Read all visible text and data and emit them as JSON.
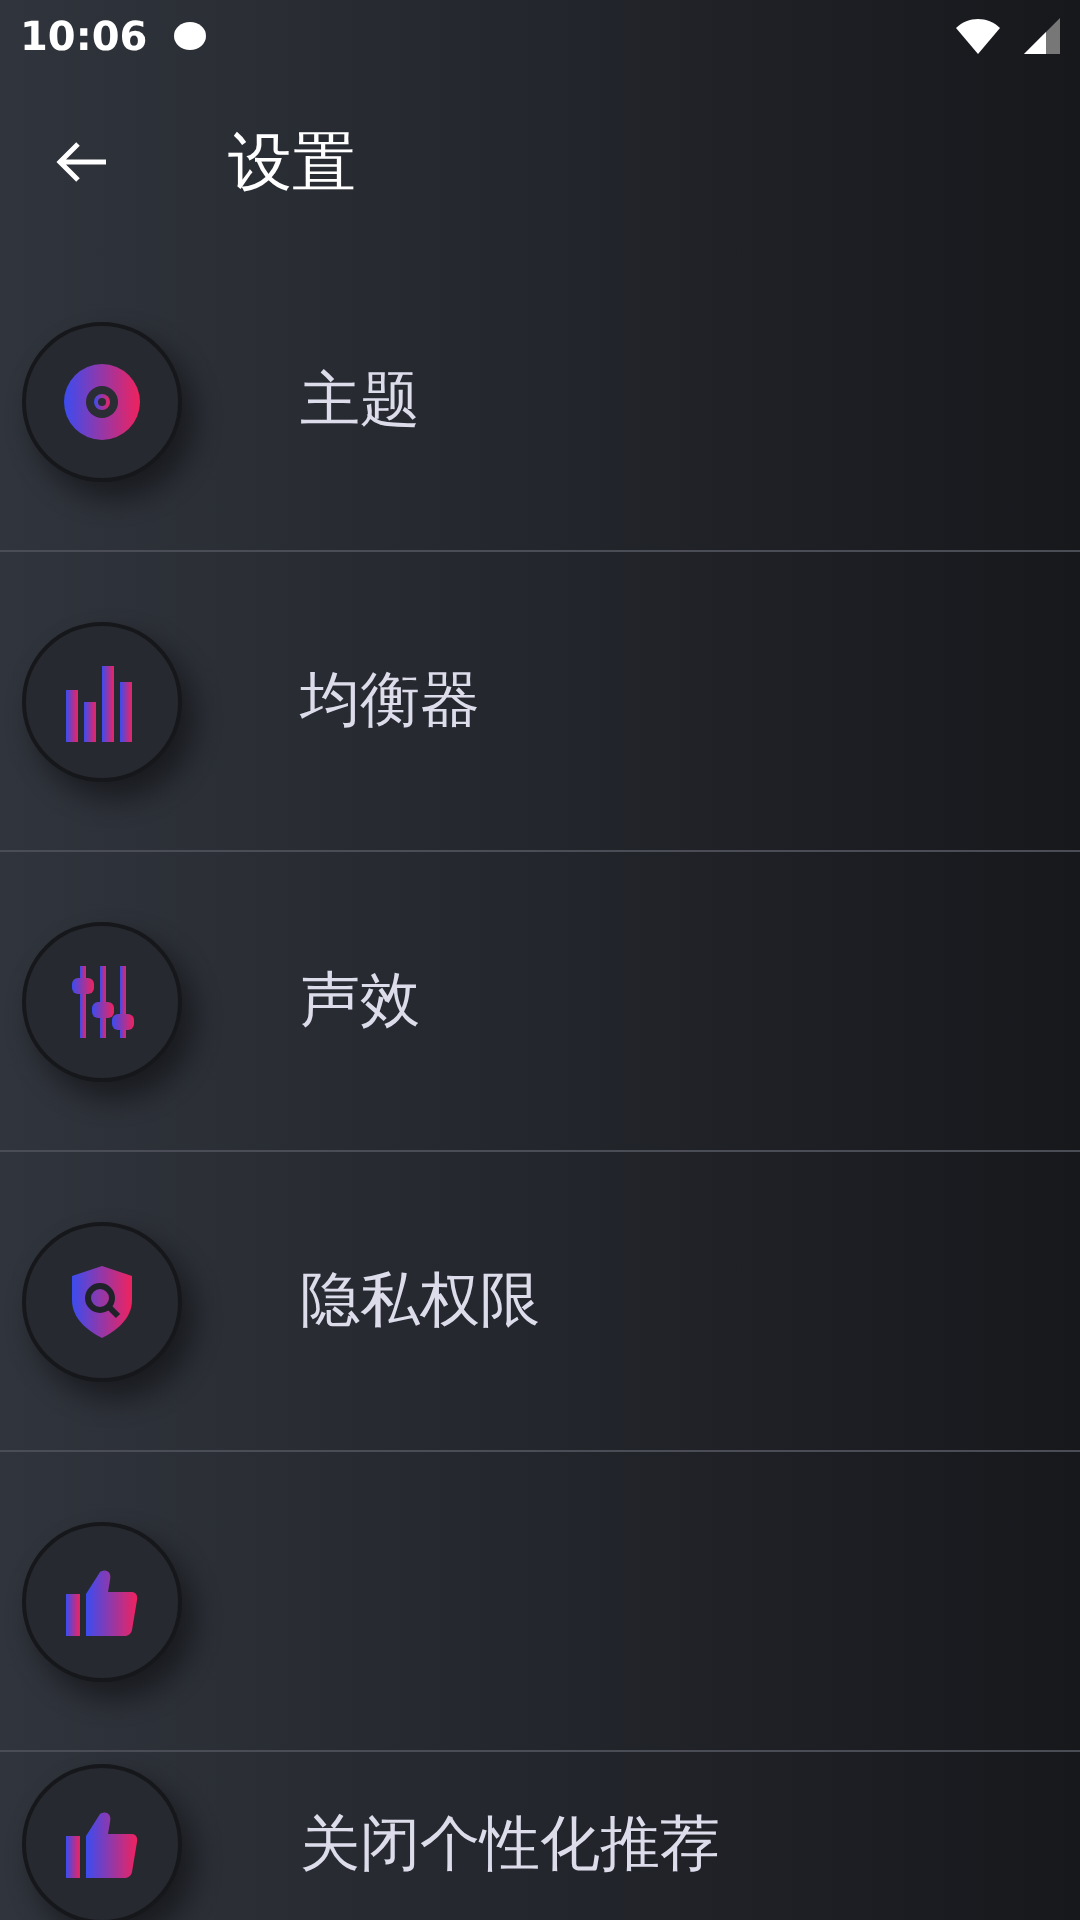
{
  "status_bar": {
    "time": "10:06"
  },
  "header": {
    "title": "设置"
  },
  "items": [
    {
      "kind": "disc",
      "label": "主题"
    },
    {
      "kind": "equalizer",
      "label": "均衡器"
    },
    {
      "kind": "sliders",
      "label": "声效"
    },
    {
      "kind": "shield",
      "label": "隐私权限"
    },
    {
      "kind": "thumb"
    },
    {
      "kind": "thumb",
      "label": "关闭个性化推荐"
    }
  ]
}
